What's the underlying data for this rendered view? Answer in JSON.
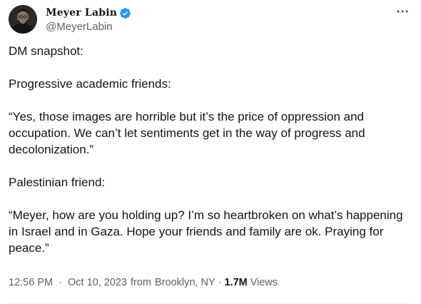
{
  "author": {
    "display_name": "Meyer Labin",
    "handle": "@MeyerLabin",
    "verified_color": "#1d9bf0",
    "avatar_icon": "profile-photo"
  },
  "tweet": {
    "paragraphs": [
      "DM snapshot:",
      "Progressive academic friends:",
      "“Yes, those images are horrible but it’s the price of oppression and occupation. We can’t let sentiments get in the way of progress and decolonization.”",
      "Palestinian friend:",
      "“Meyer, how are you holding up? I’m so heartbroken on what’s happening in Israel and in Gaza. Hope your friends and family are ok. Praying for peace.”"
    ]
  },
  "meta": {
    "time": "12:56 PM",
    "date": "Oct 10, 2023",
    "location_prefix": "from",
    "location": "Brooklyn, NY",
    "separator": "·",
    "views_count": "1.7M",
    "views_label": "Views"
  },
  "icons": {
    "more": "more-horizontal-icon",
    "verified": "verified-badge-icon"
  }
}
